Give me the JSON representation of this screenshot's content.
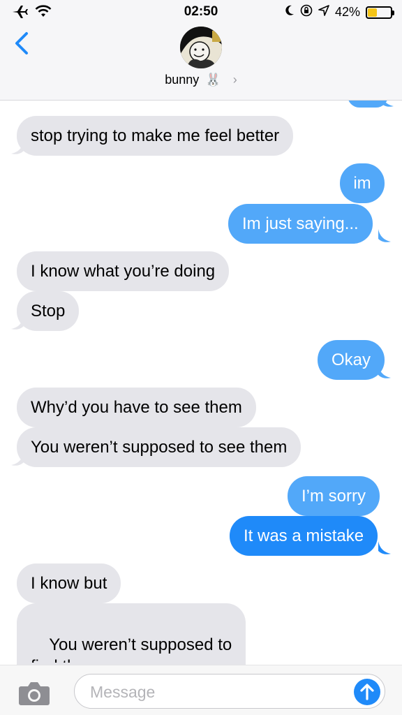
{
  "status_bar": {
    "time": "02:50",
    "battery_percent_label": "42%",
    "battery_level": 0.42,
    "icons": [
      "airplane-mode-icon",
      "wifi-icon",
      "moon-icon",
      "orientation-lock-icon",
      "location-arrow-icon",
      "battery-icon"
    ]
  },
  "header": {
    "contact_name": "bunny",
    "contact_emoji": "🐰",
    "chevron": "›",
    "avatar_icon": "avatar-image"
  },
  "messages": [
    {
      "dir": "in",
      "text": "stop trying to make me feel better"
    },
    {
      "dir": "out",
      "text": "im"
    },
    {
      "dir": "out",
      "text": "Im just saying..."
    },
    {
      "dir": "in",
      "text": "I know what you’re doing"
    },
    {
      "dir": "in",
      "text": "Stop"
    },
    {
      "dir": "out",
      "text": "Okay"
    },
    {
      "dir": "in",
      "text": "Why’d you have to see them"
    },
    {
      "dir": "in",
      "text": "You weren’t supposed to see them"
    },
    {
      "dir": "out",
      "text": "I’m sorry"
    },
    {
      "dir": "out",
      "text": "It was a mistake"
    },
    {
      "dir": "in",
      "text": "I know but"
    },
    {
      "dir": "in",
      "text": "You weren’t supposed to\nfind them"
    }
  ],
  "input_bar": {
    "placeholder": "Message",
    "camera_icon": "camera-icon",
    "send_icon": "send-arrow-icon"
  },
  "colors": {
    "incoming": "#e5e5ea",
    "outgoing": "#1f8af9",
    "outgoing_light": "#52a8f9",
    "accent": "#1f8af9"
  }
}
